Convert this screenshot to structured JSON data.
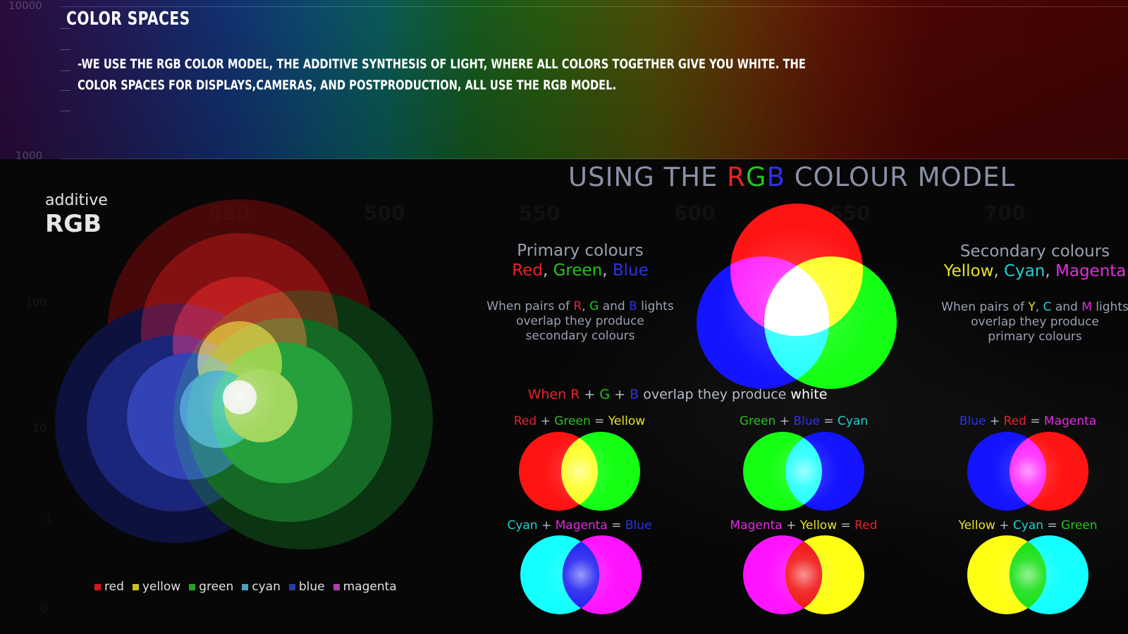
{
  "header": {
    "title": "COLOR SPACES",
    "description": "-WE USE THE RGB COLOR MODEL, THE ADDITIVE SYNTHESIS OF LIGHT, WHERE ALL COLORS TOGETHER GIVE YOU WHITE.  THE COLOR SPACES FOR DISPLAYS,CAMERAS, AND POSTPRODUCTION, ALL USE THE RGB MODEL.",
    "axis_top": "10000",
    "axis_bottom": "1000"
  },
  "left_panel": {
    "label_small": "additive",
    "label_big": "RGB",
    "faint_x_ticks": [
      "450",
      "500",
      "550",
      "600",
      "650",
      "700"
    ],
    "faint_y_ticks": [
      "100",
      "10",
      "1",
      "0"
    ],
    "legend": [
      {
        "label": "red",
        "color": "#d01a1a"
      },
      {
        "label": "yellow",
        "color": "#c8c21a"
      },
      {
        "label": "green",
        "color": "#2aa02a"
      },
      {
        "label": "cyan",
        "color": "#4aa0c0"
      },
      {
        "label": "blue",
        "color": "#2a3aa8"
      },
      {
        "label": "magenta",
        "color": "#b040a8"
      }
    ]
  },
  "right_panel": {
    "heading": {
      "pre": "USING THE ",
      "r": "R",
      "g": "G",
      "b": "B",
      "post": " COLOUR MODEL"
    },
    "primary": {
      "title": "Primary colours",
      "colors": [
        "Red",
        "Green",
        "Blue"
      ],
      "desc_1": "When pairs of ",
      "desc_r": "R",
      "desc_g": "G",
      "desc_and": " and ",
      "desc_b": "B",
      "desc_lights": " lights",
      "desc_2": "overlap they produce",
      "desc_3": "secondary colours"
    },
    "secondary": {
      "title": "Secondary colours",
      "colors": [
        "Yellow",
        "Cyan",
        "Magenta"
      ],
      "desc_1": "When pairs of ",
      "desc_y": "Y",
      "desc_c": "C",
      "desc_and": " and ",
      "desc_m": "M",
      "desc_lights": " lights",
      "desc_2": "overlap they produce",
      "desc_3": "primary colours"
    },
    "white_line": {
      "when": "When ",
      "r": "R",
      "g": "G",
      "b": "B",
      "rest": " overlap they produce ",
      "white": "white"
    },
    "equations": [
      {
        "a": "Red",
        "b": "Green",
        "c": "Yellow",
        "ca": "c-r",
        "cb": "c-g",
        "cc": "c-y"
      },
      {
        "a": "Green",
        "b": "Blue",
        "c": "Cyan",
        "ca": "c-g",
        "cb": "c-b",
        "cc": "c-c"
      },
      {
        "a": "Blue",
        "b": "Red",
        "c": "Magenta",
        "ca": "c-b",
        "cb": "c-r",
        "cc": "c-m"
      },
      {
        "a": "Cyan",
        "b": "Magenta",
        "c": "Blue",
        "ca": "c-c",
        "cb": "c-m",
        "cc": "c-b"
      },
      {
        "a": "Magenta",
        "b": "Yellow",
        "c": "Red",
        "ca": "c-m",
        "cb": "c-y",
        "cc": "c-r"
      },
      {
        "a": "Yellow",
        "b": "Cyan",
        "c": "Green",
        "ca": "c-y",
        "cb": "c-c",
        "cc": "c-g"
      }
    ],
    "plus": "+",
    "equals": "="
  }
}
